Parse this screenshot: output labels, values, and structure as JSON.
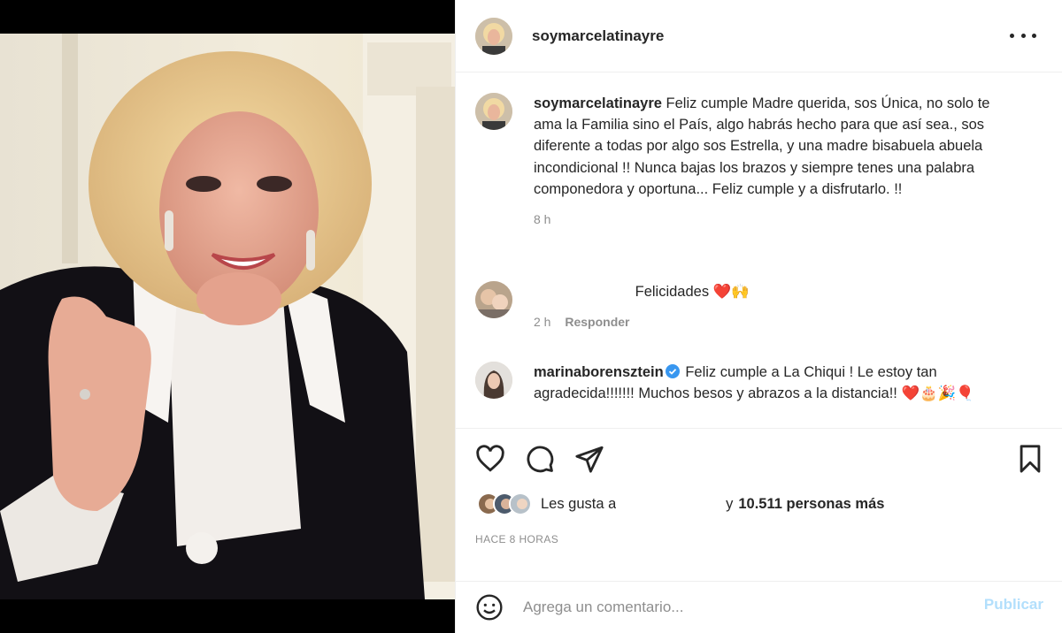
{
  "post": {
    "username": "soymarcelatinayre",
    "more_icon": "more-horizontal-icon"
  },
  "caption": {
    "username": "soymarcelatinayre",
    "text": "Feliz cumple Madre querida, sos Única, no solo te ama la Familia sino el País, algo habrás hecho para que así sea., sos diferente a todas por algo sos Estrella, y una madre bisabuela abuela incondicional !! Nunca bajas los brazos y siempre tenes una palabra componedora y oportuna... Feliz cumple y a disfrutarlo. !!",
    "time": "8 h"
  },
  "comments": [
    {
      "username": "",
      "text": "Felicidades ❤️🙌",
      "time": "2 h",
      "reply_label": "Responder"
    },
    {
      "username": "marinaborensztein",
      "verified": true,
      "text": "Feliz cumple a La Chiqui ! Le estoy tan agradecida!!!!!!! Muchos besos y abrazos a la distancia!! ❤️🎂🎉🎈"
    }
  ],
  "actions": {
    "like_icon": "heart-icon",
    "comment_icon": "comment-icon",
    "share_icon": "send-icon",
    "save_icon": "bookmark-icon"
  },
  "likes": {
    "prefix": "Les gusta a",
    "connector": "y",
    "count_text": "10.511 personas más"
  },
  "timestamp": "HACE 8 HORAS",
  "add_comment": {
    "placeholder": "Agrega un comentario...",
    "publish_label": "Publicar"
  },
  "colors": {
    "text": "#262626",
    "muted": "#8e8e8e",
    "publish_disabled": "#b2dffc",
    "verified": "#3897f0",
    "heart_red": "#ed4956"
  }
}
